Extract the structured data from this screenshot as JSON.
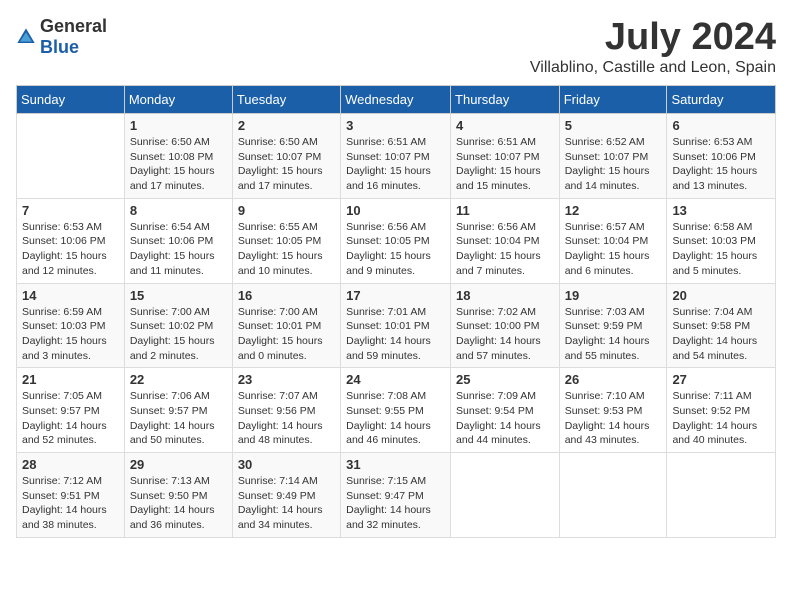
{
  "logo": {
    "general": "General",
    "blue": "Blue"
  },
  "title": "July 2024",
  "location": "Villablino, Castille and Leon, Spain",
  "weekdays": [
    "Sunday",
    "Monday",
    "Tuesday",
    "Wednesday",
    "Thursday",
    "Friday",
    "Saturday"
  ],
  "weeks": [
    [
      {
        "day": "",
        "info": ""
      },
      {
        "day": "1",
        "info": "Sunrise: 6:50 AM\nSunset: 10:08 PM\nDaylight: 15 hours\nand 17 minutes."
      },
      {
        "day": "2",
        "info": "Sunrise: 6:50 AM\nSunset: 10:07 PM\nDaylight: 15 hours\nand 17 minutes."
      },
      {
        "day": "3",
        "info": "Sunrise: 6:51 AM\nSunset: 10:07 PM\nDaylight: 15 hours\nand 16 minutes."
      },
      {
        "day": "4",
        "info": "Sunrise: 6:51 AM\nSunset: 10:07 PM\nDaylight: 15 hours\nand 15 minutes."
      },
      {
        "day": "5",
        "info": "Sunrise: 6:52 AM\nSunset: 10:07 PM\nDaylight: 15 hours\nand 14 minutes."
      },
      {
        "day": "6",
        "info": "Sunrise: 6:53 AM\nSunset: 10:06 PM\nDaylight: 15 hours\nand 13 minutes."
      }
    ],
    [
      {
        "day": "7",
        "info": "Sunrise: 6:53 AM\nSunset: 10:06 PM\nDaylight: 15 hours\nand 12 minutes."
      },
      {
        "day": "8",
        "info": "Sunrise: 6:54 AM\nSunset: 10:06 PM\nDaylight: 15 hours\nand 11 minutes."
      },
      {
        "day": "9",
        "info": "Sunrise: 6:55 AM\nSunset: 10:05 PM\nDaylight: 15 hours\nand 10 minutes."
      },
      {
        "day": "10",
        "info": "Sunrise: 6:56 AM\nSunset: 10:05 PM\nDaylight: 15 hours\nand 9 minutes."
      },
      {
        "day": "11",
        "info": "Sunrise: 6:56 AM\nSunset: 10:04 PM\nDaylight: 15 hours\nand 7 minutes."
      },
      {
        "day": "12",
        "info": "Sunrise: 6:57 AM\nSunset: 10:04 PM\nDaylight: 15 hours\nand 6 minutes."
      },
      {
        "day": "13",
        "info": "Sunrise: 6:58 AM\nSunset: 10:03 PM\nDaylight: 15 hours\nand 5 minutes."
      }
    ],
    [
      {
        "day": "14",
        "info": "Sunrise: 6:59 AM\nSunset: 10:03 PM\nDaylight: 15 hours\nand 3 minutes."
      },
      {
        "day": "15",
        "info": "Sunrise: 7:00 AM\nSunset: 10:02 PM\nDaylight: 15 hours\nand 2 minutes."
      },
      {
        "day": "16",
        "info": "Sunrise: 7:00 AM\nSunset: 10:01 PM\nDaylight: 15 hours\nand 0 minutes."
      },
      {
        "day": "17",
        "info": "Sunrise: 7:01 AM\nSunset: 10:01 PM\nDaylight: 14 hours\nand 59 minutes."
      },
      {
        "day": "18",
        "info": "Sunrise: 7:02 AM\nSunset: 10:00 PM\nDaylight: 14 hours\nand 57 minutes."
      },
      {
        "day": "19",
        "info": "Sunrise: 7:03 AM\nSunset: 9:59 PM\nDaylight: 14 hours\nand 55 minutes."
      },
      {
        "day": "20",
        "info": "Sunrise: 7:04 AM\nSunset: 9:58 PM\nDaylight: 14 hours\nand 54 minutes."
      }
    ],
    [
      {
        "day": "21",
        "info": "Sunrise: 7:05 AM\nSunset: 9:57 PM\nDaylight: 14 hours\nand 52 minutes."
      },
      {
        "day": "22",
        "info": "Sunrise: 7:06 AM\nSunset: 9:57 PM\nDaylight: 14 hours\nand 50 minutes."
      },
      {
        "day": "23",
        "info": "Sunrise: 7:07 AM\nSunset: 9:56 PM\nDaylight: 14 hours\nand 48 minutes."
      },
      {
        "day": "24",
        "info": "Sunrise: 7:08 AM\nSunset: 9:55 PM\nDaylight: 14 hours\nand 46 minutes."
      },
      {
        "day": "25",
        "info": "Sunrise: 7:09 AM\nSunset: 9:54 PM\nDaylight: 14 hours\nand 44 minutes."
      },
      {
        "day": "26",
        "info": "Sunrise: 7:10 AM\nSunset: 9:53 PM\nDaylight: 14 hours\nand 43 minutes."
      },
      {
        "day": "27",
        "info": "Sunrise: 7:11 AM\nSunset: 9:52 PM\nDaylight: 14 hours\nand 40 minutes."
      }
    ],
    [
      {
        "day": "28",
        "info": "Sunrise: 7:12 AM\nSunset: 9:51 PM\nDaylight: 14 hours\nand 38 minutes."
      },
      {
        "day": "29",
        "info": "Sunrise: 7:13 AM\nSunset: 9:50 PM\nDaylight: 14 hours\nand 36 minutes."
      },
      {
        "day": "30",
        "info": "Sunrise: 7:14 AM\nSunset: 9:49 PM\nDaylight: 14 hours\nand 34 minutes."
      },
      {
        "day": "31",
        "info": "Sunrise: 7:15 AM\nSunset: 9:47 PM\nDaylight: 14 hours\nand 32 minutes."
      },
      {
        "day": "",
        "info": ""
      },
      {
        "day": "",
        "info": ""
      },
      {
        "day": "",
        "info": ""
      }
    ]
  ]
}
